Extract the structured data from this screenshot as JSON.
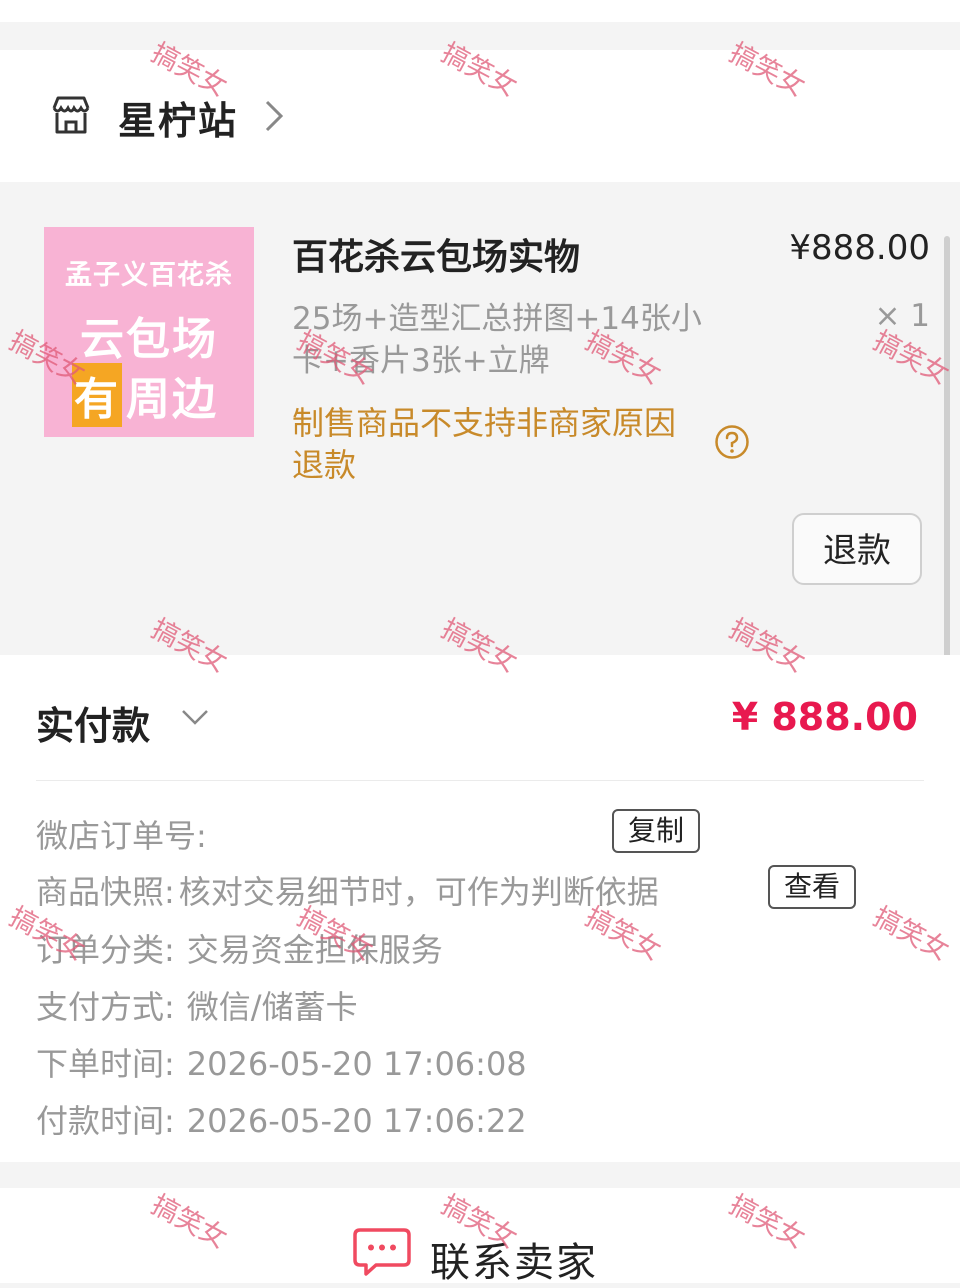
{
  "store": {
    "name": "星柠站"
  },
  "product": {
    "image_text": {
      "line1": "孟子义百花杀",
      "line2": "云包场",
      "line3_badge": "有",
      "line3_rest": "周边"
    },
    "title": "百花杀云包场实物",
    "price": "¥888.00",
    "spec": "25场+造型汇总拼图+14张小卡+香片3张+立牌",
    "quantity": "× 1",
    "refund_notice": "制售商品不支持非商家原因退款",
    "refund_button": "退款"
  },
  "payment": {
    "label": "实付款",
    "amount": "¥ 888.00"
  },
  "order_info": {
    "order_no_label": "微店订单号:",
    "copy_button": "复制",
    "snapshot_label": "商品快照:",
    "snapshot_value": "核对交易细节时，可作为判断依据",
    "view_button": "查看",
    "category_label": "订单分类:",
    "category_value": "交易资金担保服务",
    "pay_method_label": "支付方式:",
    "pay_method_value": "微信/储蓄卡",
    "order_time_label": "下单时间:",
    "order_time_value": "2026-05-20 17:06:08",
    "pay_time_label": "付款时间:",
    "pay_time_value": "2026-05-20 17:06:22"
  },
  "contact": {
    "label": "联系卖家"
  },
  "watermark_text": "搞笑女",
  "colors": {
    "price_red": "#e8194f",
    "notice_orange": "#c88a2a",
    "watermark": "#e05a77",
    "image_pink": "#f8b3d4"
  },
  "icons": [
    "store-icon",
    "chevron-right-icon",
    "help-icon",
    "chevron-down-icon",
    "chat-bubble-icon"
  ]
}
